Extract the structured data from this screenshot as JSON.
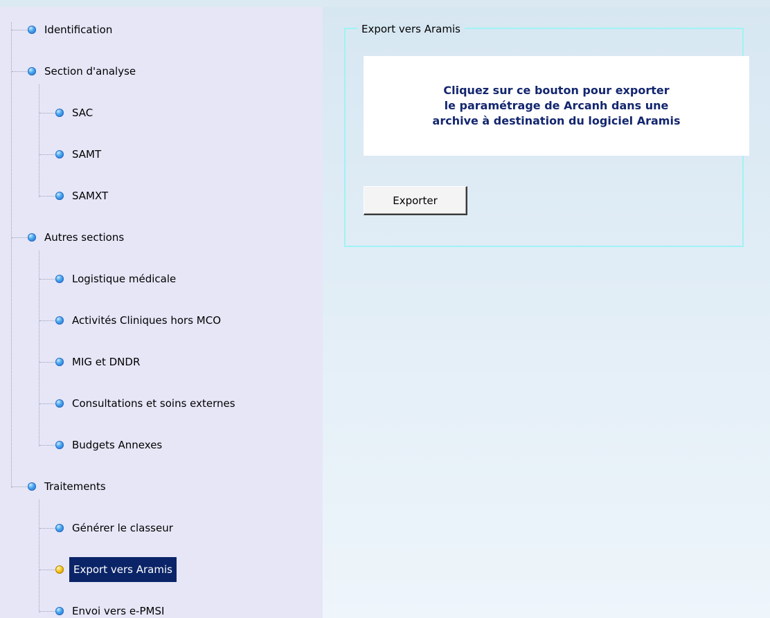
{
  "tree": {
    "items": [
      {
        "label": "Identification",
        "selected": false
      },
      {
        "label": "Section d'analyse",
        "selected": false
      },
      {
        "label": "SAC",
        "selected": false
      },
      {
        "label": "SAMT",
        "selected": false
      },
      {
        "label": "SAMXT",
        "selected": false
      },
      {
        "label": "Autres sections",
        "selected": false
      },
      {
        "label": "Logistique médicale",
        "selected": false
      },
      {
        "label": "Activités Cliniques hors MCO",
        "selected": false
      },
      {
        "label": "MIG et DNDR",
        "selected": false
      },
      {
        "label": "Consultations et soins externes",
        "selected": false
      },
      {
        "label": "Budgets Annexes",
        "selected": false
      },
      {
        "label": "Traitements",
        "selected": false
      },
      {
        "label": "Générer le classeur",
        "selected": false
      },
      {
        "label": "Export vers Aramis",
        "selected": true
      },
      {
        "label": "Envoi vers e-PMSI",
        "selected": false
      }
    ]
  },
  "panel": {
    "group_title": "Export vers Aramis",
    "info_text": "Cliquez sur ce bouton pour exporter\nle paramétrage de Arcanh dans une\narchive à destination du logiciel Aramis",
    "export_button_label": "Exporter"
  },
  "colors": {
    "selection_bg": "#0a2467",
    "info_text": "#13266e",
    "groupbox_border": "#9ff3f5",
    "tree_bg": "#e6e6f7"
  }
}
